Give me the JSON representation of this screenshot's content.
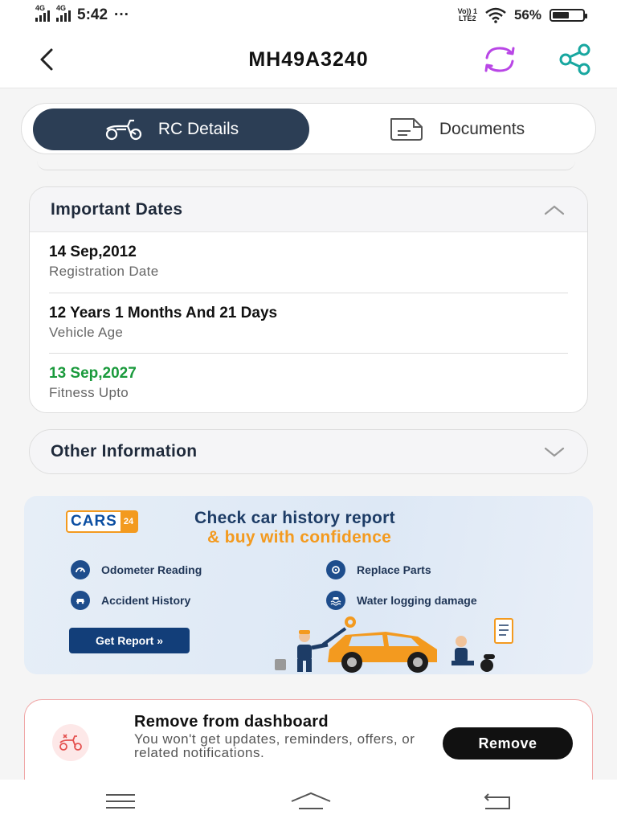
{
  "status_bar": {
    "net1": "4G",
    "net2": "4G",
    "time": "5:42",
    "dots": "···",
    "volte_top": "Vo)) 1",
    "volte_bottom": "LTE2",
    "battery": "56%",
    "battery_level": 0.56
  },
  "app_bar": {
    "title": "MH49A3240",
    "icons": [
      "back-arrow-icon",
      "refresh-icon",
      "share-icon"
    ]
  },
  "tabs": [
    {
      "label": "RC Details",
      "icon": "scooter-icon",
      "active": true
    },
    {
      "label": "Documents",
      "icon": "document-icon",
      "active": false
    }
  ],
  "important_dates": {
    "title": "Important Dates",
    "expanded": true,
    "rows": [
      {
        "value": "14 Sep,2012",
        "label": "Registration Date"
      },
      {
        "value": "12 Years 1 Months And 21 Days",
        "label": "Vehicle Age"
      },
      {
        "value": "13 Sep,2027",
        "label": "Fitness Upto"
      }
    ]
  },
  "other_information": {
    "title": "Other Information",
    "expanded": false
  },
  "promo": {
    "logo_text": "CARS",
    "logo_num": "24",
    "headline_1": "Check car history report",
    "headline_2": "& buy with confidence",
    "features": [
      "Odometer Reading",
      "Replace Parts",
      "Accident History",
      "Water logging damage"
    ],
    "cta": "Get Report »"
  },
  "remove_card": {
    "title": "Remove from dashboard",
    "description": "You won't get updates, reminders, offers, or related notifications.",
    "button": "Remove"
  },
  "colors": {
    "tab_active_bg": "#2c3e55",
    "fitness_green": "#1a9a3c",
    "refresh_purple": "#b946e6",
    "share_teal": "#18a7a0",
    "brand_orange": "#f39a1f",
    "brand_blue": "#123e79"
  }
}
